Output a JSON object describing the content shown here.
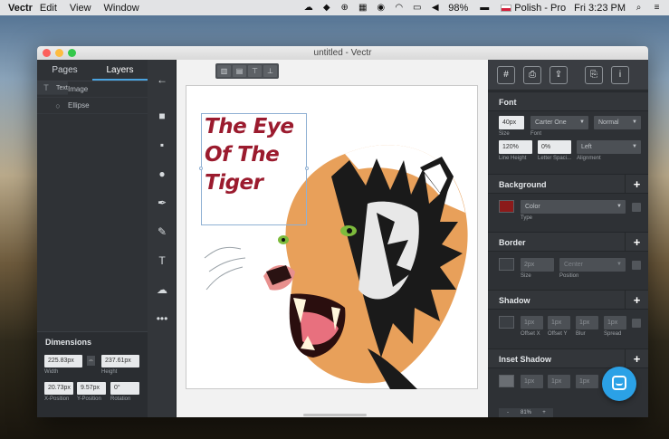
{
  "menubar": {
    "app": "Vectr",
    "items": [
      "Edit",
      "View",
      "Window"
    ],
    "battery": "98%",
    "input_source": "Polish - Pro",
    "clock": "Fri 3:23 PM"
  },
  "window": {
    "title": "untitled - Vectr"
  },
  "left_panel": {
    "tabs": [
      {
        "label": "Pages"
      },
      {
        "label": "Layers"
      }
    ],
    "layers": [
      {
        "label": "Text",
        "icon": "text-icon"
      },
      {
        "label": "Image",
        "icon": "image-icon"
      },
      {
        "label": "Ellipse",
        "icon": "ellipse-icon"
      }
    ],
    "dimensions": {
      "title": "Dimensions",
      "width": {
        "value": "225.83px",
        "label": "Width"
      },
      "height": {
        "value": "237.61px",
        "label": "Height"
      },
      "x": {
        "value": "20.73px",
        "label": "X-Position"
      },
      "y": {
        "value": "9.57px",
        "label": "Y-Position"
      },
      "rotation": {
        "value": "0°",
        "label": "Rotation"
      }
    }
  },
  "canvas": {
    "text_lines": [
      "The Eye",
      "Of The",
      "Tiger"
    ],
    "text_color": "#9b1b2e"
  },
  "inspector": {
    "font": {
      "title": "Font",
      "size": {
        "value": "40px",
        "label": "Size"
      },
      "family": {
        "value": "Carter One",
        "label": "Font"
      },
      "weight": {
        "value": "Normal"
      },
      "line_height": {
        "value": "120%",
        "label": "Line Height"
      },
      "letter_spacing": {
        "value": "0%",
        "label": "Letter Spaci..."
      },
      "alignment": {
        "value": "Left",
        "label": "Alignment"
      }
    },
    "background": {
      "title": "Background",
      "color": "#8b1a1a",
      "type": {
        "value": "Color",
        "label": "Type"
      }
    },
    "border": {
      "title": "Border",
      "size": {
        "value": "2px",
        "label": "Size"
      },
      "position": {
        "value": "Center",
        "label": "Position"
      }
    },
    "shadow": {
      "title": "Shadow",
      "fields": [
        {
          "value": "1px",
          "label": "Offset X"
        },
        {
          "value": "1px",
          "label": "Offset Y"
        },
        {
          "value": "1px",
          "label": "Blur"
        },
        {
          "value": "1px",
          "label": "Spread"
        }
      ]
    },
    "inset_shadow": {
      "title": "Inset Shadow",
      "fields": [
        {
          "value": "1px"
        },
        {
          "value": "1px"
        },
        {
          "value": "1px"
        }
      ]
    },
    "zoom": {
      "minus": "-",
      "value": "81%",
      "plus": "+"
    }
  }
}
